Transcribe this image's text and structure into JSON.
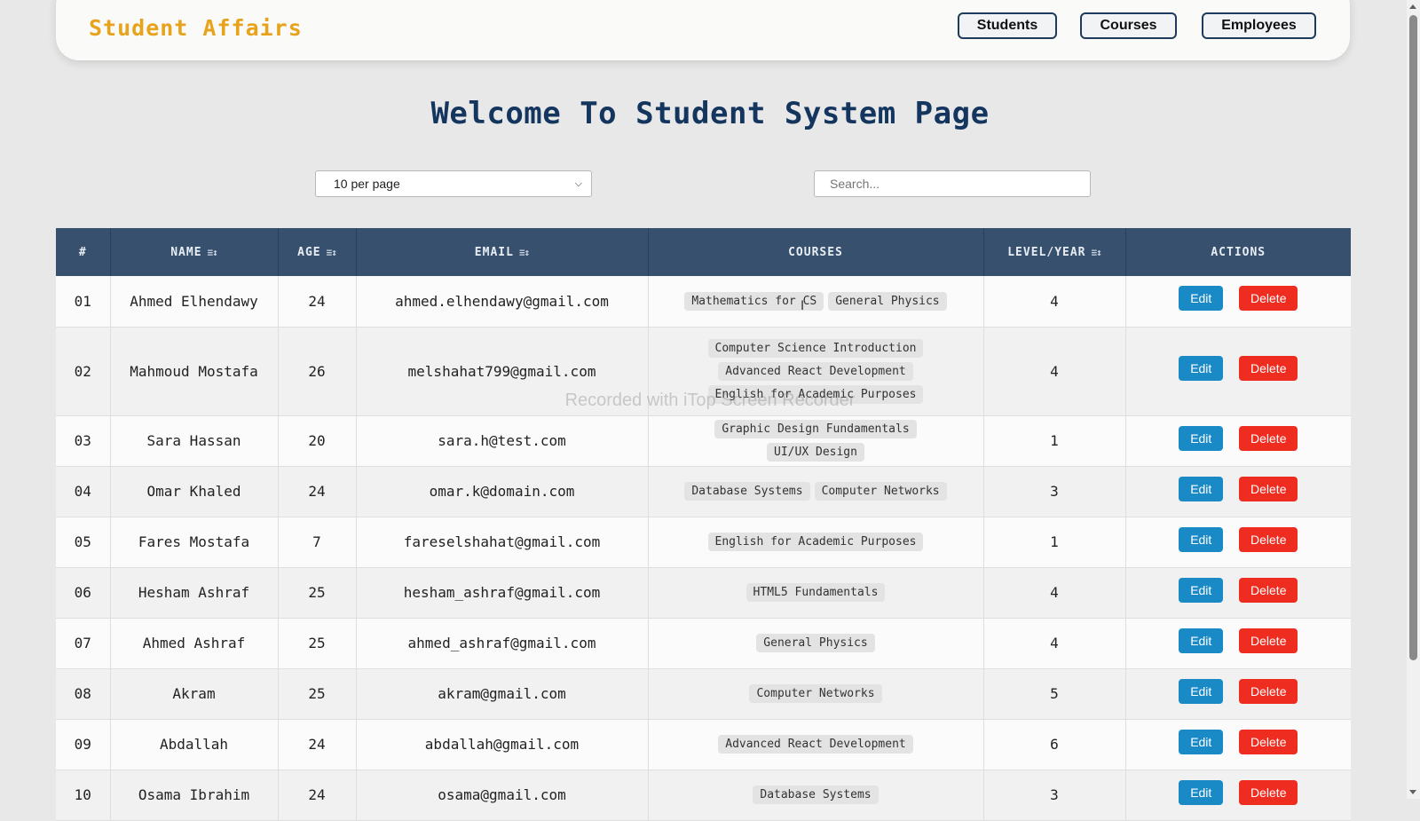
{
  "header": {
    "brand": "Student Affairs",
    "nav": [
      "Students",
      "Courses",
      "Employees"
    ]
  },
  "page_title": "Welcome To Student System Page",
  "controls": {
    "per_page_value": "10 per page",
    "search_placeholder": "Search..."
  },
  "table": {
    "columns": [
      "#",
      "NAME",
      "AGE",
      "EMAIL",
      "COURSES",
      "LEVEL/YEAR",
      "ACTIONS"
    ],
    "edit_label": "Edit",
    "delete_label": "Delete",
    "rows": [
      {
        "id": "01",
        "name": "Ahmed Elhendawy",
        "age": "24",
        "email": "ahmed.elhendawy@gmail.com",
        "courses": [
          "Mathematics for CS",
          "General Physics"
        ],
        "level": "4"
      },
      {
        "id": "02",
        "name": "Mahmoud Mostafa",
        "age": "26",
        "email": "melshahat799@gmail.com",
        "courses": [
          "Computer Science Introduction",
          "Advanced React Development",
          "English for Academic Purposes"
        ],
        "level": "4"
      },
      {
        "id": "03",
        "name": "Sara Hassan",
        "age": "20",
        "email": "sara.h@test.com",
        "courses": [
          "Graphic Design Fundamentals",
          "UI/UX Design"
        ],
        "level": "1"
      },
      {
        "id": "04",
        "name": "Omar Khaled",
        "age": "24",
        "email": "omar.k@domain.com",
        "courses": [
          "Database Systems",
          "Computer Networks"
        ],
        "level": "3"
      },
      {
        "id": "05",
        "name": "Fares Mostafa",
        "age": "7",
        "email": "fareselshahat@gmail.com",
        "courses": [
          "English for Academic Purposes"
        ],
        "level": "1"
      },
      {
        "id": "06",
        "name": "Hesham Ashraf",
        "age": "25",
        "email": "hesham_ashraf@gmail.com",
        "courses": [
          "HTML5 Fundamentals"
        ],
        "level": "4"
      },
      {
        "id": "07",
        "name": "Ahmed Ashraf",
        "age": "25",
        "email": "ahmed_ashraf@gmail.com",
        "courses": [
          "General Physics"
        ],
        "level": "4"
      },
      {
        "id": "08",
        "name": "Akram",
        "age": "25",
        "email": "akram@gmail.com",
        "courses": [
          "Computer Networks"
        ],
        "level": "5"
      },
      {
        "id": "09",
        "name": "Abdallah",
        "age": "24",
        "email": "abdallah@gmail.com",
        "courses": [
          "Advanced React Development"
        ],
        "level": "6"
      },
      {
        "id": "10",
        "name": "Osama Ibrahim",
        "age": "24",
        "email": "osama@gmail.com",
        "courses": [
          "Database Systems"
        ],
        "level": "3"
      }
    ]
  },
  "watermark": "Recorded with iTop Screen Recorder",
  "icons": {
    "sort": "sort-icon",
    "dropdown": "chevron-down-icon"
  },
  "colors": {
    "brand": "#e8a31c",
    "title": "#13355e",
    "table_header": "#36506e",
    "edit": "#1a8ac7",
    "delete": "#ee2c1f"
  }
}
